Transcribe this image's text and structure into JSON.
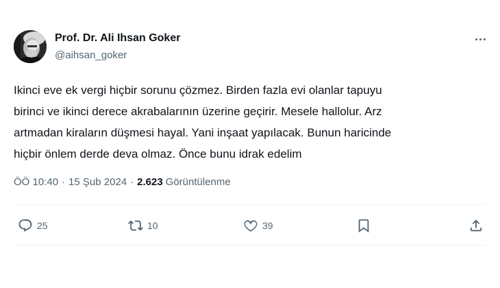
{
  "author": {
    "display_name": "Prof. Dr. Ali Ihsan Goker",
    "handle": "@aihsan_goker",
    "avatar_icon": "profile-photo"
  },
  "tweet": {
    "lines": [
      "Ikinci eve ek vergi hiçbir sorunu çözmez. Birden fazla evi olanlar tapuyu",
      "birinci ve ikinci derece akrabalarının üzerine geçirir. Mesele hallolur. Arz",
      "artmadan kiraların düşmesi hayal. Yani inşaat yapılacak. Bunun haricinde",
      "hiçbir önlem derde deva olmaz. Önce bunu idrak edelim"
    ]
  },
  "meta": {
    "time": "ÖÖ 10:40",
    "separator": "·",
    "date": "15 Şub 2024",
    "views_count": "2.623",
    "views_label": "Görüntülenme"
  },
  "actions": {
    "replies": "25",
    "retweets": "10",
    "likes": "39"
  },
  "colors": {
    "text": "#0f1419",
    "secondary": "#536471",
    "divider": "#eff3f4"
  }
}
